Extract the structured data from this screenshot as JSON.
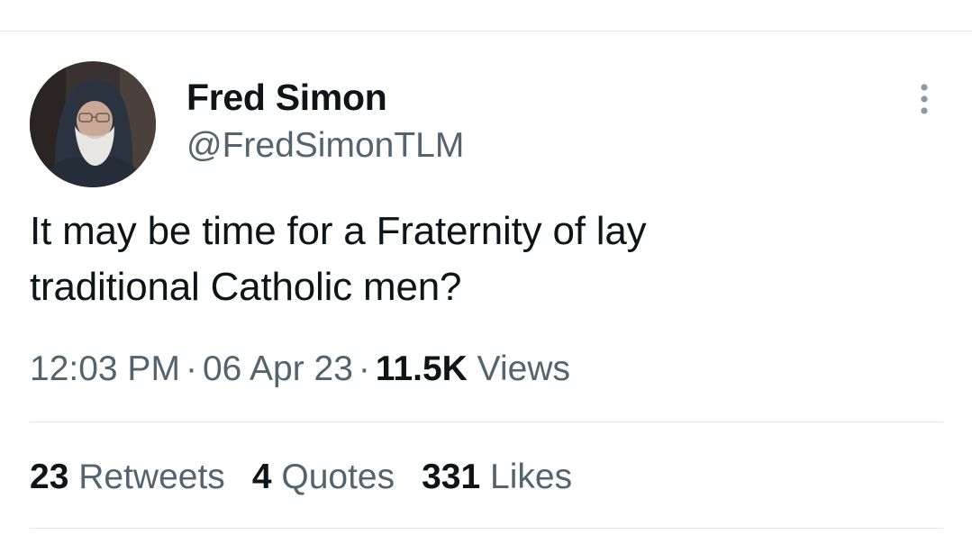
{
  "tweet": {
    "author": {
      "display_name": "Fred Simon",
      "handle": "@FredSimonTLM",
      "avatar_icon": "user-avatar-hooded-man"
    },
    "more_icon": "more-vertical-icon",
    "text_line_1": "It may be time for a Fraternity of lay",
    "text_line_2": "traditional Catholic men?",
    "time": "12:03 PM",
    "date": "06 Apr 23",
    "separator": "·",
    "views_count": "11.5K",
    "views_label": "Views"
  },
  "stats": {
    "retweets_count": "23",
    "retweets_label": "Retweets",
    "quotes_count": "4",
    "quotes_label": "Quotes",
    "likes_count": "331",
    "likes_label": "Likes"
  },
  "colors": {
    "primary_text": "#0f1419",
    "secondary_text": "#536471",
    "divider": "#e1e5e8"
  }
}
